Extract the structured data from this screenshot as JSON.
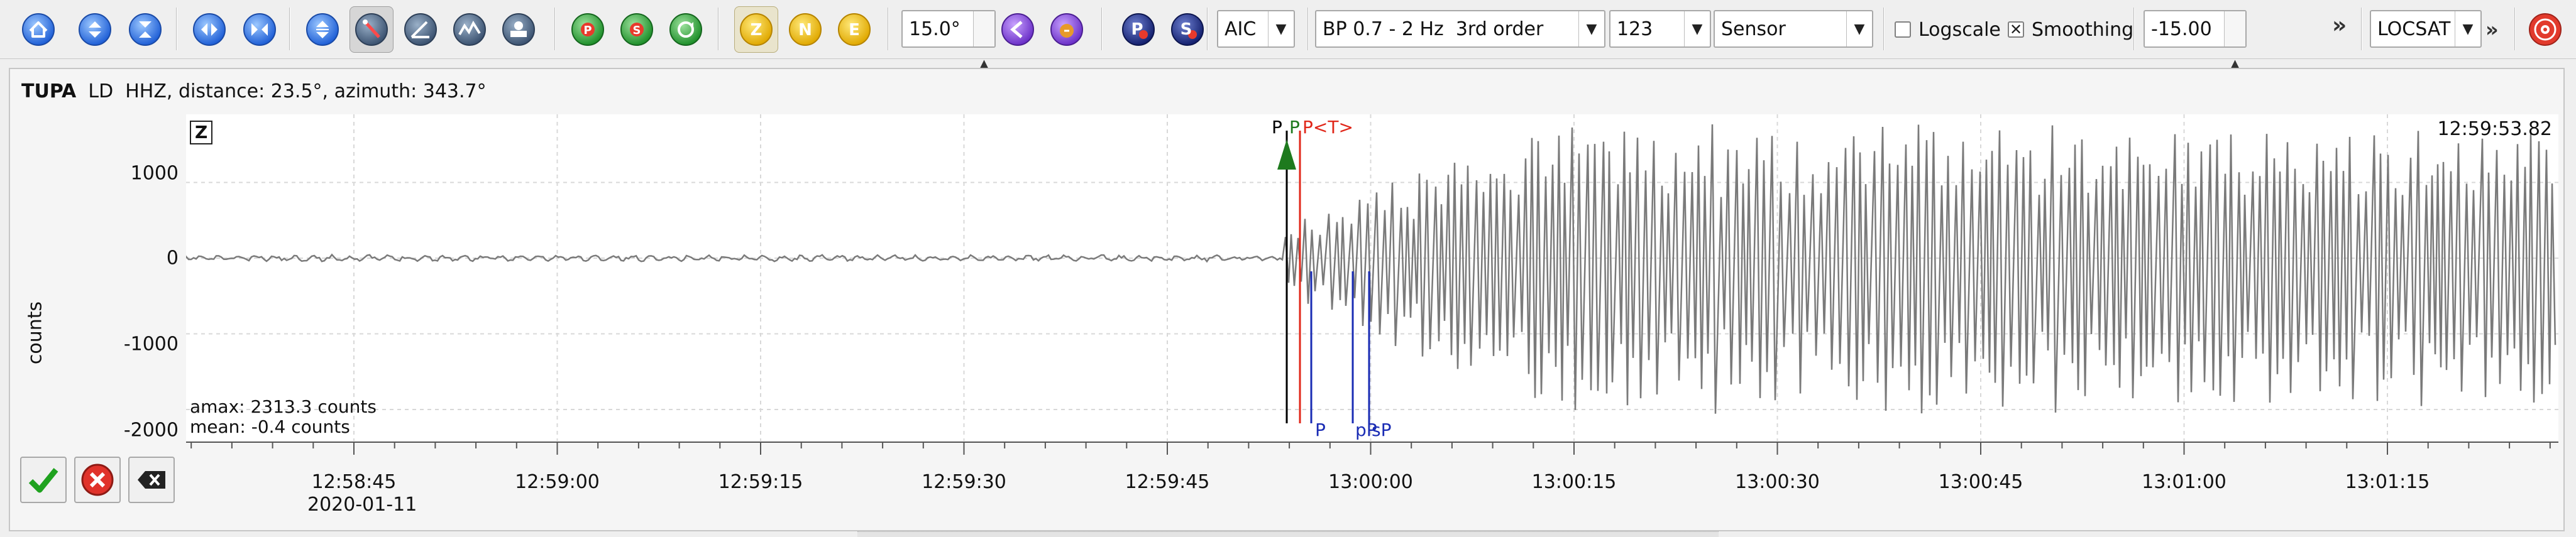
{
  "toolbar": {
    "nav_buttons": [
      "home-icon",
      "scroll-up-icon",
      "zoom-collapse-icon",
      "scroll-left-icon",
      "zoom-horizontal-icon",
      "zoom-vertical-icon"
    ],
    "tool_buttons": [
      "pick-tool-icon",
      "angle-tool-icon",
      "spectrogram-icon",
      "rotate-icon"
    ],
    "phase_buttons": [
      "phase-p-icon",
      "phase-s-icon",
      "phase-rotate-icon"
    ],
    "components": [
      {
        "label": "Z",
        "active": true
      },
      {
        "label": "N",
        "active": false
      },
      {
        "label": "E",
        "active": false
      }
    ],
    "distance_value": "15.0°",
    "theoretical_buttons": [
      "pick-theoretical-icon",
      "velocity-icon"
    ],
    "pick_p_label": "P",
    "pick_s_label": "S",
    "autopick_method": "AIC",
    "filter": "BP 0.7 - 2 Hz  3rd order",
    "component_combo": "123",
    "unit_combo": "Sensor",
    "logscale_label": "Logscale",
    "logscale_checked": false,
    "smoothing_label": "Smoothing",
    "smoothing_checked": true,
    "offset_value": "-15.00",
    "overflow_1": "»",
    "locator": "LOCSAT",
    "overflow_2": "»",
    "colors": {
      "component_yellow": "#f2c300",
      "pick_p": "#1a2c8a",
      "pick_s": "#1a2c8a",
      "stop_red": "#e23a2c"
    }
  },
  "trace": {
    "station": "TUPA",
    "network_info": "LD  HHZ, distance: 23.5°, azimuth: 343.7°",
    "component": "Z",
    "timestamp": "12:59:53.82",
    "y_label": "counts",
    "y_ticks": [
      "1000",
      "0",
      "-1000",
      "-2000"
    ],
    "amax": "amax: 2313.3 counts",
    "mean": "mean: -0.4 counts",
    "date": "2020-01-11",
    "x_ticks": [
      "12:58:45",
      "12:59:00",
      "12:59:15",
      "12:59:30",
      "12:59:45",
      "13:00:00",
      "13:00:15",
      "13:00:30",
      "13:00:45",
      "13:01:00",
      "13:01:15"
    ],
    "picks_top": [
      {
        "label": "P",
        "color": "#000000"
      },
      {
        "label": "P",
        "color": "#1e7a1e"
      },
      {
        "label": "P<T>",
        "color": "#e0271a"
      }
    ],
    "picks_bottom": [
      {
        "label": "P",
        "color": "#1a2cb4"
      },
      {
        "label": "pP",
        "color": "#1a2cb4"
      },
      {
        "label": "sP",
        "color": "#1a2cb4"
      }
    ],
    "colors": {
      "trace": "#7a7a7a",
      "grid": "#d8d8d8"
    }
  },
  "actions": [
    "accept-icon",
    "reject-icon",
    "clear-icon"
  ]
}
